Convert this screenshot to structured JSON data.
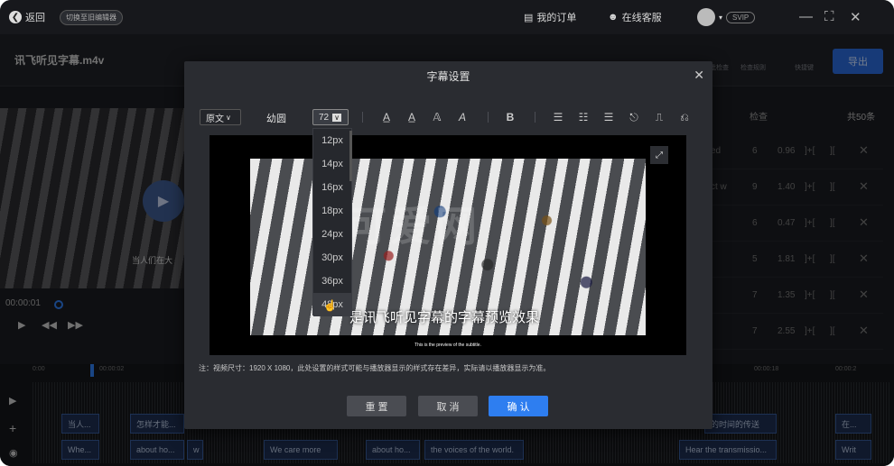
{
  "topbar": {
    "back_label": "返回",
    "switch_label": "切换至旧编辑器",
    "orders_label": "我的订单",
    "service_label": "在线客服",
    "svip_label": "SVIP"
  },
  "file": {
    "name": "讯飞听见字幕.m4v"
  },
  "toolbar_labels": {
    "check": "批检查",
    "rules": "检查规则",
    "shortcuts": "快捷键",
    "export": "导出"
  },
  "right_panel": {
    "header_check": "检查",
    "header_count": "共50条",
    "rows": [
      {
        "text": "ed",
        "n": "6",
        "dur": "0.96"
      },
      {
        "text": "ct w",
        "n": "9",
        "dur": "1.40"
      },
      {
        "text": "",
        "n": "6",
        "dur": "0.47"
      },
      {
        "text": "",
        "n": "5",
        "dur": "1.81"
      },
      {
        "text": "",
        "n": "7",
        "dur": "1.35"
      },
      {
        "text": "",
        "n": "7",
        "dur": "2.55"
      }
    ]
  },
  "player": {
    "time": "00:00:01",
    "left_caption": "当人们在大"
  },
  "timeline": {
    "ruler": [
      "0:00",
      "00:00:02",
      "00:00:18",
      "00:00:2"
    ],
    "track1": [
      "当人...",
      "怎样才能...",
      "的时间的传送",
      "在..."
    ],
    "track2": [
      "Whe...",
      "about ho...",
      "w",
      "We care more",
      "about ho...",
      "the voices of the world.",
      "Hear the transmissio...",
      "Writ"
    ]
  },
  "modal": {
    "title": "字幕设置",
    "lang_select": "原文",
    "font_name": "幼圆",
    "font_size": "72",
    "sizes": [
      "12px",
      "14px",
      "16px",
      "18px",
      "24px",
      "30px",
      "36px",
      "48px"
    ],
    "preview_subtitle": "是讯飞听见字幕的字幕预览效果",
    "preview_subtitle_small": "This is the preview of the subtitle.",
    "watermark": "可爱网",
    "note": "注：视频尺寸：1920 X 1080，此处设置的样式可能与播放器显示的样式存在差异，实际请以播放器显示为准。",
    "reset": "重 置",
    "cancel": "取 消",
    "confirm": "确 认"
  },
  "colors": {
    "accent": "#2a6bdb",
    "confirm": "#2e7ef0",
    "background": "#1b1d22"
  }
}
